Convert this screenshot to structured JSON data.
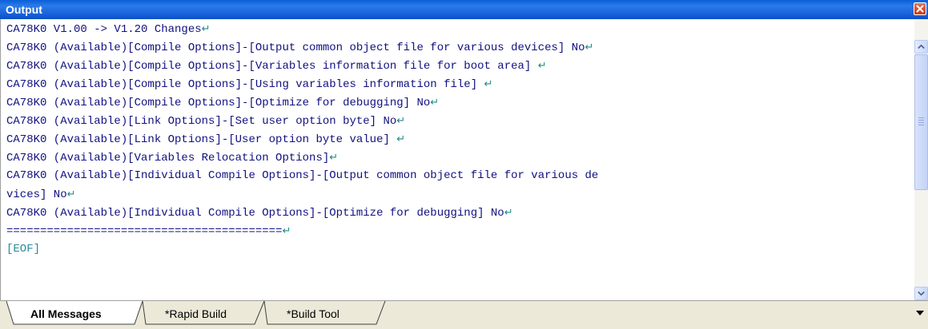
{
  "window": {
    "title": "Output"
  },
  "output": {
    "lines": [
      {
        "text": "CA78K0 V1.00 -> V1.20 Changes",
        "eol": true
      },
      {
        "text": "CA78K0 (Available)[Compile Options]-[Output common object file for various devices] No",
        "eol": true
      },
      {
        "text": "CA78K0 (Available)[Compile Options]-[Variables information file for boot area] ",
        "eol": true
      },
      {
        "text": "CA78K0 (Available)[Compile Options]-[Using variables information file] ",
        "eol": true
      },
      {
        "text": "CA78K0 (Available)[Compile Options]-[Optimize for debugging] No",
        "eol": true
      },
      {
        "text": "CA78K0 (Available)[Link Options]-[Set user option byte] No",
        "eol": true
      },
      {
        "text": "CA78K0 (Available)[Link Options]-[User option byte value] ",
        "eol": true
      },
      {
        "text": "CA78K0 (Available)[Variables Relocation Options]",
        "eol": true
      },
      {
        "text": "CA78K0 (Available)[Individual Compile Options]-[Output common object file for various de",
        "eol": false
      },
      {
        "text": "vices] No",
        "eol": true
      },
      {
        "text": "CA78K0 (Available)[Individual Compile Options]-[Optimize for debugging] No",
        "eol": true
      },
      {
        "text": "=========================================",
        "eol": true
      },
      {
        "text": "[EOF]",
        "eol": false
      }
    ],
    "eol_glyph": "↵"
  },
  "tabs": [
    {
      "label": "All Messages",
      "active": true
    },
    {
      "label": "*Rapid Build",
      "active": false
    },
    {
      "label": "*Build Tool",
      "active": false
    }
  ],
  "colors": {
    "titlebar": "#1a64dc",
    "text": "#101080",
    "eol_marker": "#1f8c84",
    "close_button": "#d9512b"
  },
  "icons": {
    "close": "close-icon",
    "scroll_up": "scroll-up-icon",
    "scroll_down": "scroll-down-icon",
    "tabs_menu": "chevron-down-icon"
  }
}
